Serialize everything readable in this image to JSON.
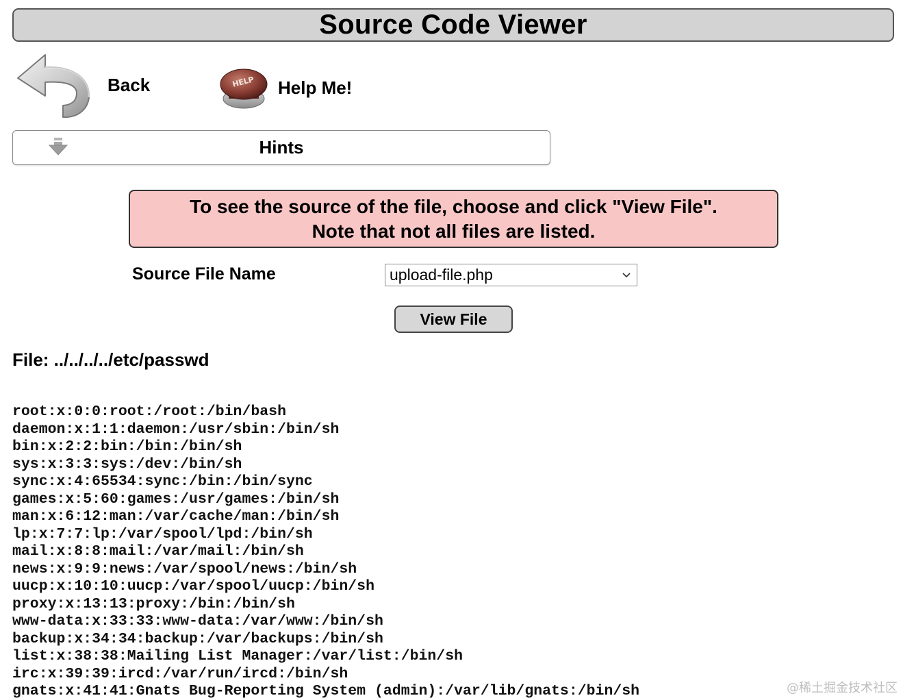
{
  "header": {
    "title": "Source Code Viewer"
  },
  "nav": {
    "back_label": "Back",
    "back_icon": "back-arrow-icon",
    "help_label": "Help Me!",
    "help_icon": "help-button-icon",
    "help_icon_text": "HELP"
  },
  "hints": {
    "label": "Hints",
    "icon": "expand-down-arrow-icon"
  },
  "notice": {
    "line1": "To see the source of the file, choose and click \"View File\".",
    "line2": "Note that not all files are listed."
  },
  "form": {
    "source_file_label": "Source File Name",
    "selected_file": "upload-file.php",
    "view_button_label": "View File"
  },
  "file": {
    "heading": "File: ../../../../etc/passwd",
    "lines": [
      "root:x:0:0:root:/root:/bin/bash",
      "daemon:x:1:1:daemon:/usr/sbin:/bin/sh",
      "bin:x:2:2:bin:/bin:/bin/sh",
      "sys:x:3:3:sys:/dev:/bin/sh",
      "sync:x:4:65534:sync:/bin:/bin/sync",
      "games:x:5:60:games:/usr/games:/bin/sh",
      "man:x:6:12:man:/var/cache/man:/bin/sh",
      "lp:x:7:7:lp:/var/spool/lpd:/bin/sh",
      "mail:x:8:8:mail:/var/mail:/bin/sh",
      "news:x:9:9:news:/var/spool/news:/bin/sh",
      "uucp:x:10:10:uucp:/var/spool/uucp:/bin/sh",
      "proxy:x:13:13:proxy:/bin:/bin/sh",
      "www-data:x:33:33:www-data:/var/www:/bin/sh",
      "backup:x:34:34:backup:/var/backups:/bin/sh",
      "list:x:38:38:Mailing List Manager:/var/list:/bin/sh",
      "irc:x:39:39:ircd:/var/run/ircd:/bin/sh",
      "gnats:x:41:41:Gnats Bug-Reporting System (admin):/var/lib/gnats:/bin/sh"
    ]
  },
  "watermark": "@稀土掘金技术社区"
}
